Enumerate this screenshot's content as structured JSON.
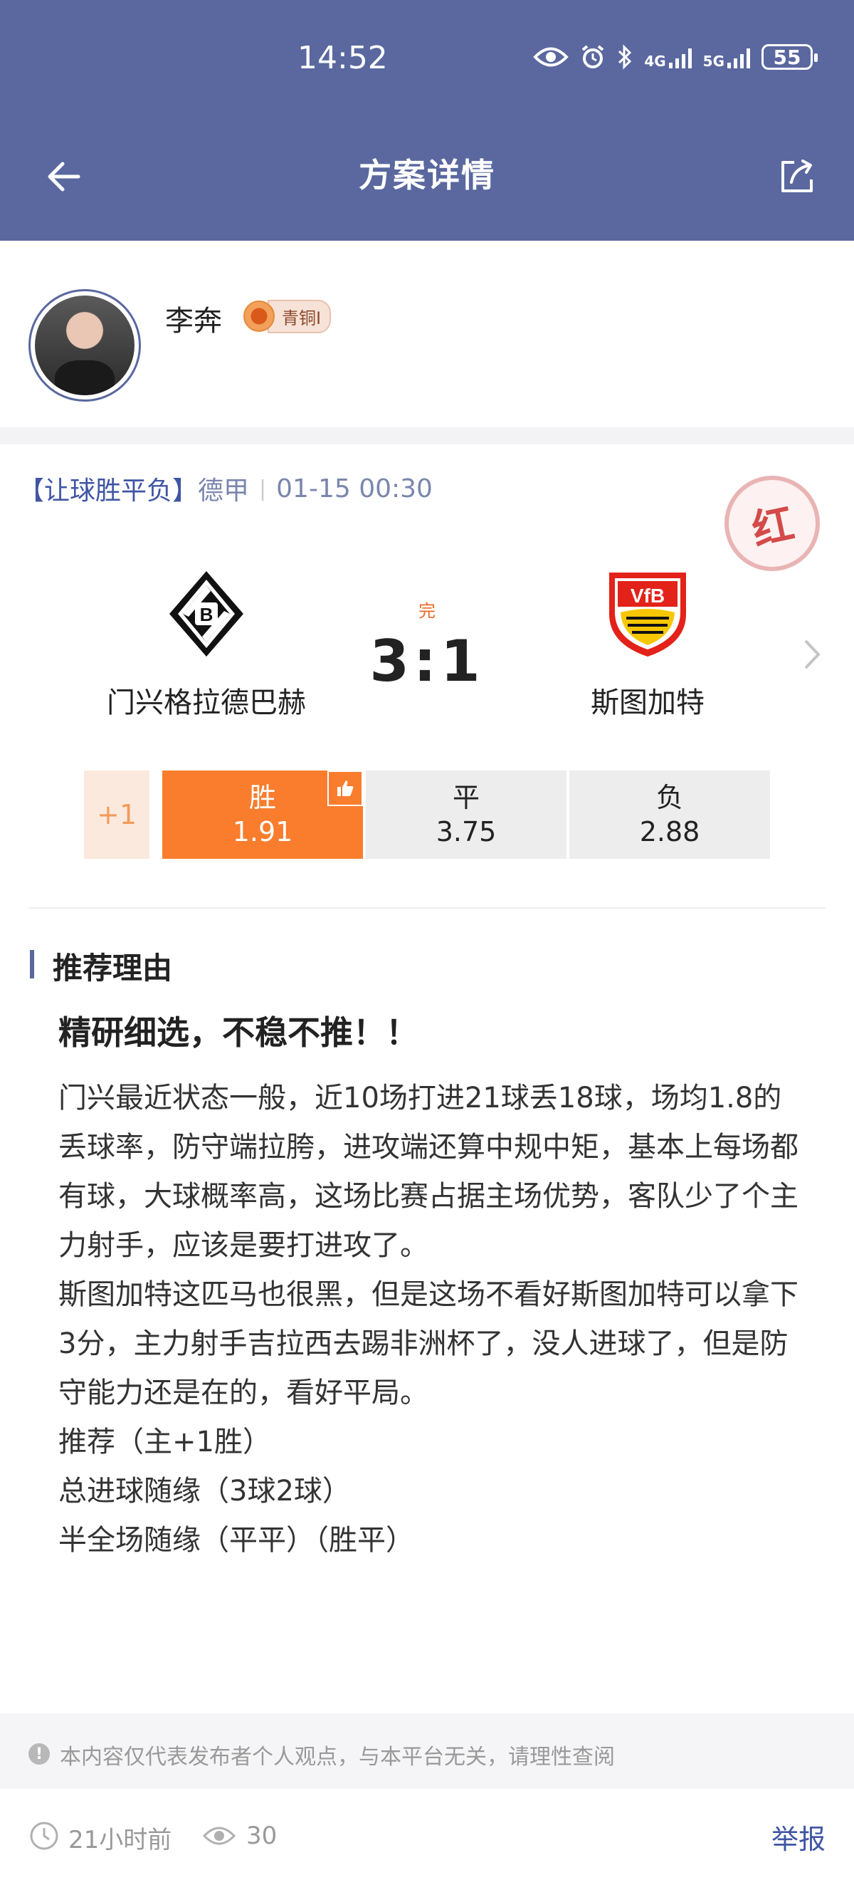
{
  "status_bar": {
    "time": "14:52",
    "signal_1": "4G",
    "signal_2": "5G",
    "battery": "55"
  },
  "header": {
    "title": "方案详情",
    "back_icon": "arrow-left-icon",
    "share_icon": "share-icon"
  },
  "author": {
    "name": "李奔",
    "rank": "青铜I"
  },
  "match": {
    "play_type": "【让球胜平负】",
    "league": "德甲",
    "separator": "|",
    "datetime": "01-15  00:30",
    "result_stamp": "红",
    "status": "完",
    "score": "3:1",
    "home_team": "门兴格拉德巴赫",
    "away_team": "斯图加特",
    "handicap": "+1",
    "odds": [
      {
        "label": "胜",
        "value": "1.91",
        "selected": true
      },
      {
        "label": "平",
        "value": "3.75",
        "selected": false
      },
      {
        "label": "负",
        "value": "2.88",
        "selected": false
      }
    ]
  },
  "reason": {
    "section_title": "推荐理由",
    "headline": "精研细选，不稳不推！！",
    "paragraphs": [
      "门兴最近状态一般，近10场打进21球丢18球，场均1.8的丢球率，防守端拉胯，进攻端还算中规中矩，基本上每场都有球，大球概率高，这场比赛占据主场优势，客队少了个主力射手，应该是要打进攻了。",
      "斯图加特这匹马也很黑，但是这场不看好斯图加特可以拿下3分，主力射手吉拉西去踢非洲杯了，没人进球了，但是防守能力还是在的，看好平局。",
      "推荐（主+1胜）",
      "总进球随缘（3球2球）",
      "半全场随缘（平平）（胜平）"
    ]
  },
  "disclaimer": "本内容仅代表发布者个人观点，与本平台无关，请理性查阅",
  "footer": {
    "time_ago": "21小时前",
    "views": "30",
    "report": "举报"
  },
  "colors": {
    "header_bg": "#5a689f",
    "accent_orange": "#f97d2d",
    "link_blue": "#3f55a4",
    "stamp_red": "#d44a4a"
  }
}
